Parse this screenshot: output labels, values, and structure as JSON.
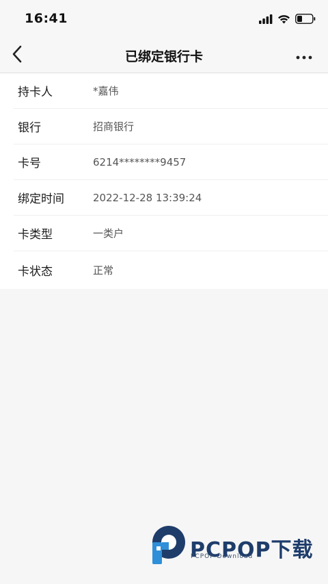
{
  "status_bar": {
    "time": "16:41"
  },
  "nav": {
    "title": "已绑定银行卡",
    "back_icon": "chevron-left-icon",
    "more_icon": "more-horizontal-icon"
  },
  "details": [
    {
      "label": "持卡人",
      "value": "*嘉伟"
    },
    {
      "label": "银行",
      "value": "招商银行"
    },
    {
      "label": "卡号",
      "value": "6214********9457"
    },
    {
      "label": "绑定时间",
      "value": "2022-12-28 13:39:24"
    },
    {
      "label": "卡类型",
      "value": "一类户"
    },
    {
      "label": "卡状态",
      "value": "正常"
    }
  ],
  "watermark": {
    "text": "PCPOP下载",
    "subtext": "PCPOP Download"
  },
  "colors": {
    "background": "#f6f6f6",
    "card": "#ffffff",
    "watermark_brand": "#1e3d6b",
    "watermark_accent": "#2f8fd8"
  }
}
